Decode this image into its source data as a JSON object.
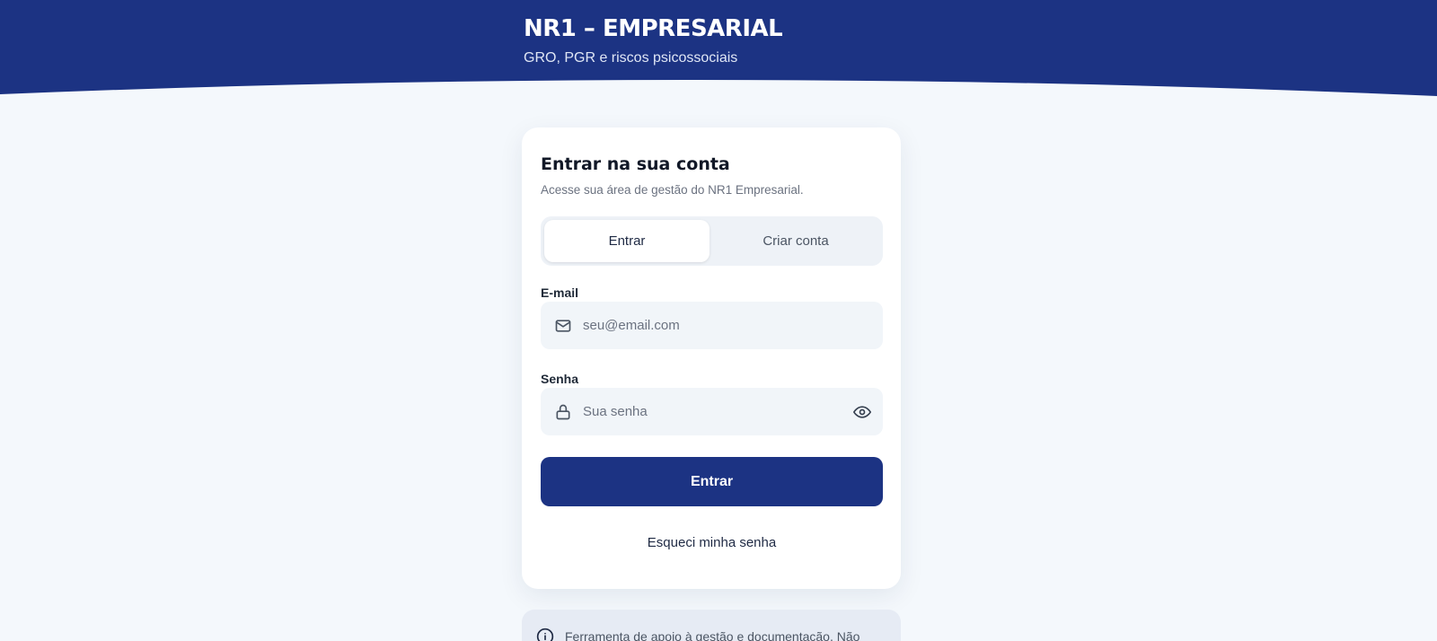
{
  "header": {
    "title": "NR1 – EMPRESARIAL",
    "subtitle": "GRO, PGR e riscos psicossociais"
  },
  "card": {
    "title": "Entrar na sua conta",
    "subtitle": "Acesse sua área de gestão do NR1 Empresarial."
  },
  "tabs": [
    {
      "label": "Entrar",
      "active": true
    },
    {
      "label": "Criar conta",
      "active": false
    }
  ],
  "form": {
    "email_label": "E-mail",
    "email_placeholder": "seu@email.com",
    "email_value": "",
    "email_icon": "mail-icon",
    "password_label": "Senha",
    "password_placeholder": "Sua senha",
    "password_value": "",
    "password_icon": "lock-icon",
    "reveal_icon": "eye-icon",
    "submit_label": "Entrar",
    "forgot_label": "Esqueci minha senha"
  },
  "notice": {
    "icon": "info-icon",
    "text": "Ferramenta de apoio à gestão e documentação. Não"
  },
  "colors": {
    "brand": "#1c3383",
    "page_bg": "#f4f8fc",
    "card_bg": "#ffffff",
    "field_bg": "#f1f5f9"
  }
}
